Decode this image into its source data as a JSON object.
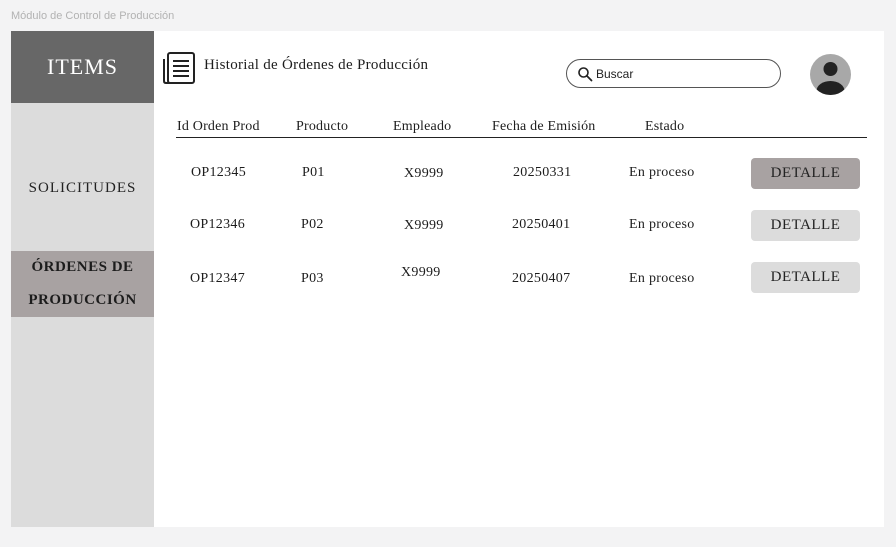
{
  "frame": {
    "title": "Módulo de Control de Producción"
  },
  "sidebar": {
    "header": "ITEMS",
    "items": [
      {
        "label": "SOLICITUDES"
      },
      {
        "label_line1": "ÓRDENES DE",
        "label_line2": "PRODUCCIÓN"
      }
    ]
  },
  "header": {
    "title": "Historial de Órdenes de Producción",
    "search_placeholder": "Buscar"
  },
  "table": {
    "columns": [
      "Id Orden Prod",
      "Producto",
      "Empleado",
      "Fecha de Emisión",
      "Estado"
    ],
    "rows": [
      {
        "id": "OP12345",
        "producto": "P01",
        "empleado": "X9999",
        "fecha": "20250331",
        "estado": "En proceso",
        "action": "DETALLE"
      },
      {
        "id": "OP12346",
        "producto": "P02",
        "empleado": "X9999",
        "fecha": "20250401",
        "estado": "En proceso",
        "action": "DETALLE"
      },
      {
        "id": "OP12347",
        "producto": "P03",
        "empleado": "X9999",
        "fecha": "20250407",
        "estado": "En proceso",
        "action": "DETALLE"
      }
    ]
  },
  "colors": {
    "sidebar_bg": "#dcdcdc",
    "sidebar_header_bg": "#676767",
    "active_nav_bg": "#a8a2a2",
    "button_bg": "#dcdcdc",
    "button_active_bg": "#a8a2a2"
  },
  "icons": {
    "header": "document-icon",
    "search": "search-icon",
    "user": "avatar-icon"
  }
}
